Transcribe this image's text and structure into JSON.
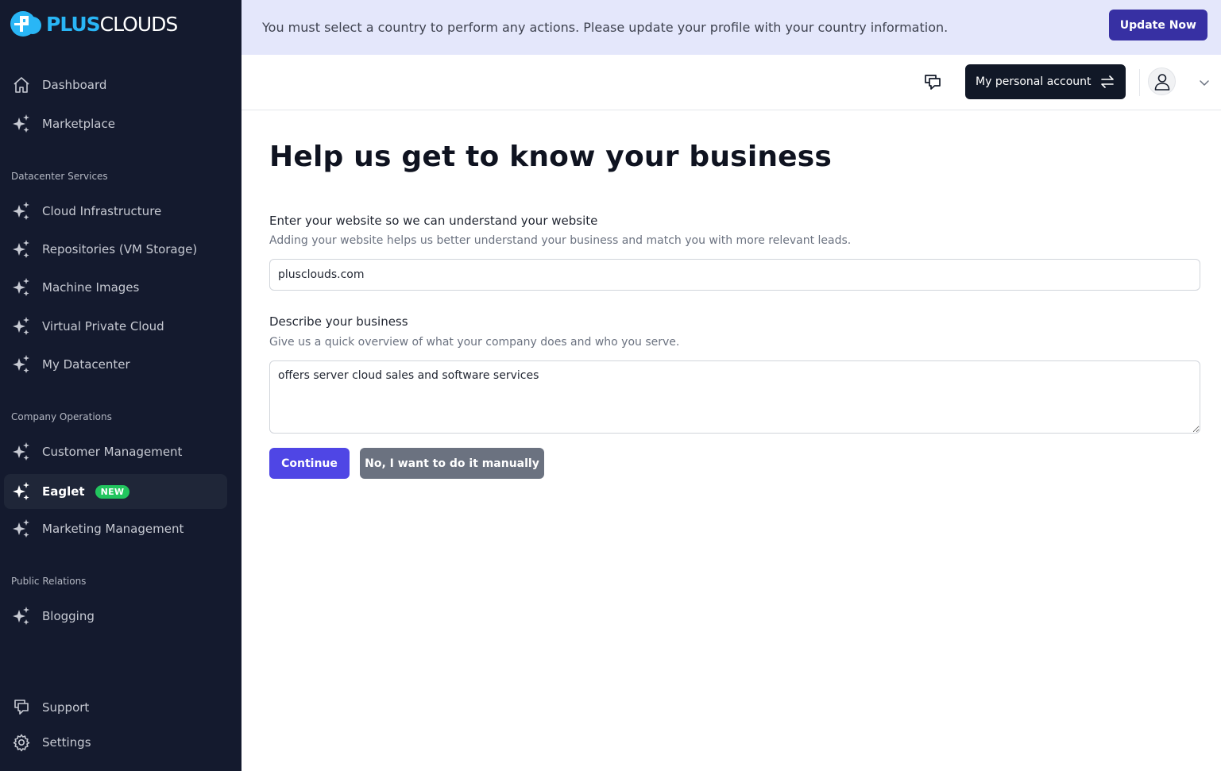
{
  "brand": {
    "plus": "PLUS",
    "clouds": "CLOUDS"
  },
  "banner": {
    "message": "You must select a country to perform any actions. Please update your profile with your country information.",
    "button": "Update Now"
  },
  "sidebar": {
    "top_items": [
      {
        "label": "Dashboard",
        "icon": "home-icon"
      },
      {
        "label": "Marketplace",
        "icon": "sparkles-icon"
      }
    ],
    "sections": [
      {
        "title": "Datacenter Services",
        "items": [
          {
            "label": "Cloud Infrastructure",
            "icon": "sparkles-icon"
          },
          {
            "label": "Repositories (VM Storage)",
            "icon": "sparkles-icon"
          },
          {
            "label": "Machine Images",
            "icon": "sparkles-icon"
          },
          {
            "label": "Virtual Private Cloud",
            "icon": "sparkles-icon"
          },
          {
            "label": "My Datacenter",
            "icon": "sparkles-icon"
          }
        ]
      },
      {
        "title": "Company Operations",
        "items": [
          {
            "label": "Customer Management",
            "icon": "sparkles-icon"
          },
          {
            "label": "Eaglet",
            "icon": "sparkles-icon",
            "badge": "NEW",
            "active": true
          },
          {
            "label": "Marketing Management",
            "icon": "sparkles-icon"
          }
        ]
      },
      {
        "title": "Public Relations",
        "items": [
          {
            "label": "Blogging",
            "icon": "sparkles-icon"
          }
        ]
      }
    ],
    "bottom_items": [
      {
        "label": "Support",
        "icon": "chat-icon"
      },
      {
        "label": "Settings",
        "icon": "gear-icon"
      }
    ]
  },
  "topbar": {
    "account_label": "My personal account"
  },
  "main": {
    "title": "Help us get to know your business",
    "website": {
      "label": "Enter your website so we can understand your website",
      "help": "Adding your website helps us better understand your business and match you with more relevant leads.",
      "value": "plusclouds.com"
    },
    "business": {
      "label": "Describe your business",
      "help": "Give us a quick overview of what your company does and who you serve.",
      "value": "offers server cloud sales and software services"
    },
    "continue_button": "Continue",
    "manual_button": "No, I want to do it manually"
  },
  "colors": {
    "sidebar_bg": "#141a2e",
    "banner_bg": "#e4e7fb",
    "primary": "#4f46e5",
    "update_button": "#3730a3",
    "new_badge": "#22c55e",
    "secondary_button": "#6b7280"
  }
}
